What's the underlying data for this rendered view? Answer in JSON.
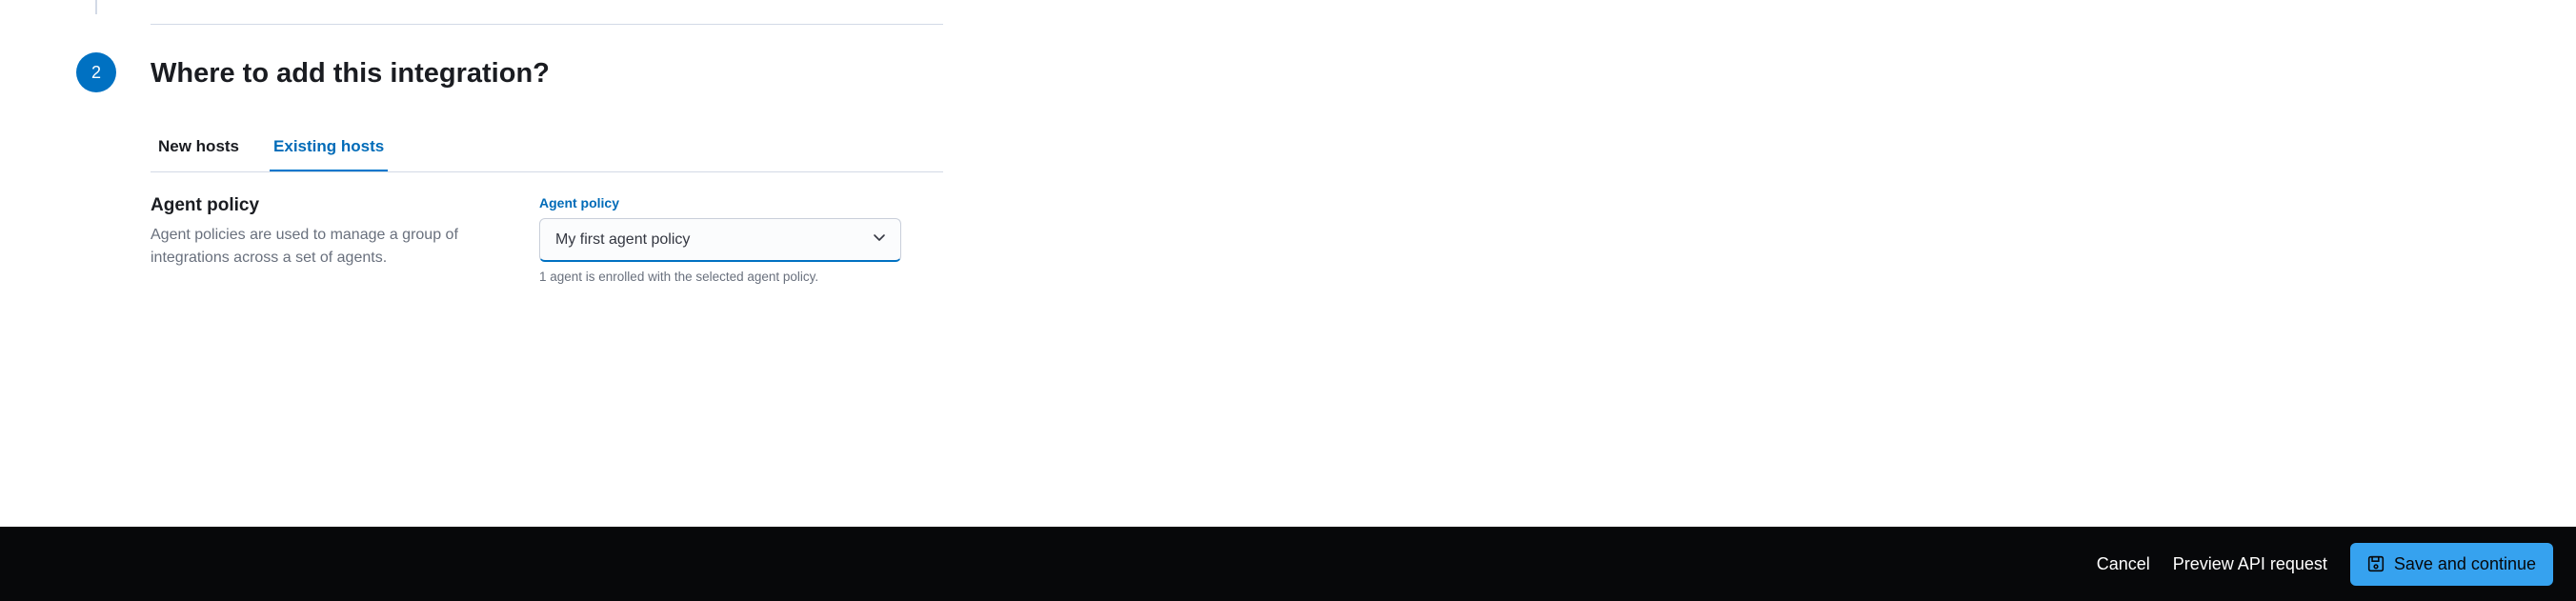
{
  "step": {
    "number": "2",
    "title": "Where to add this integration?"
  },
  "tabs": {
    "new_hosts": "New hosts",
    "existing_hosts": "Existing hosts"
  },
  "agent_policy": {
    "heading": "Agent policy",
    "description": "Agent policies are used to manage a group of integrations across a set of agents.",
    "field_label": "Agent policy",
    "selected": "My first agent policy",
    "helper": "1 agent is enrolled with the selected agent policy."
  },
  "footer": {
    "cancel": "Cancel",
    "preview": "Preview API request",
    "save": "Save and continue"
  }
}
